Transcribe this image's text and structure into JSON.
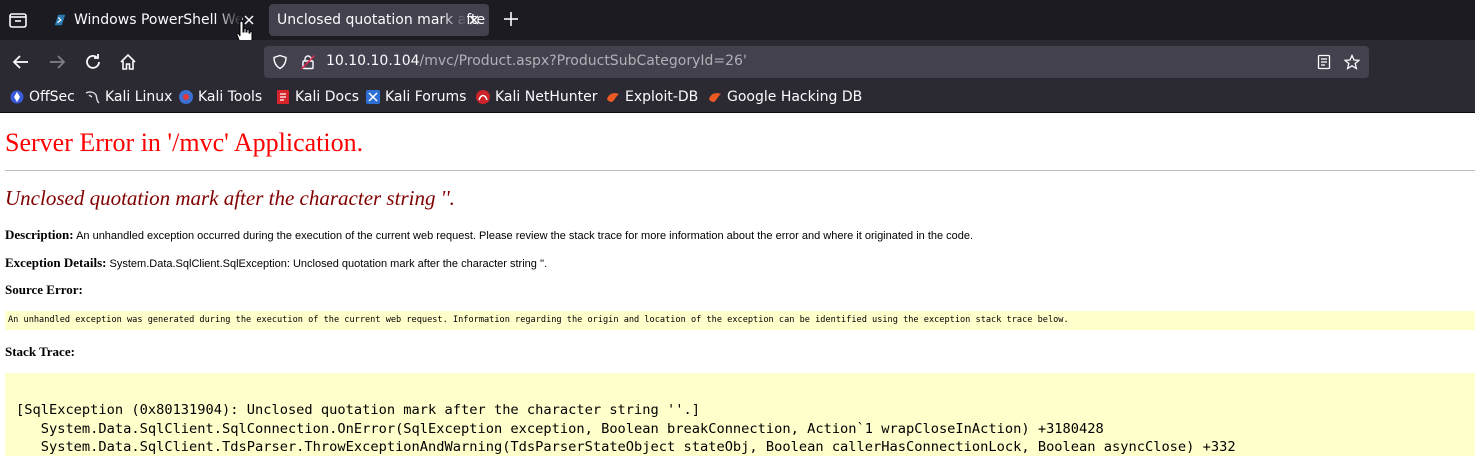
{
  "browser": {
    "tabs": [
      {
        "title": "Windows PowerShell We",
        "active": false
      },
      {
        "title": "Unclosed quotation mark afte",
        "active": true
      }
    ],
    "url": {
      "host": "10.10.10.104",
      "path": "/mvc/Product.aspx?ProductSubCategoryId=26'"
    },
    "bookmarks": [
      {
        "label": "OffSec",
        "icon": "offsec-icon"
      },
      {
        "label": "Kali Linux",
        "icon": "kali-dragon-icon"
      },
      {
        "label": "Kali Tools",
        "icon": "kali-tools-icon"
      },
      {
        "label": "Kali Docs",
        "icon": "kali-docs-icon"
      },
      {
        "label": "Kali Forums",
        "icon": "kali-forums-icon"
      },
      {
        "label": "Kali NetHunter",
        "icon": "nethunter-icon"
      },
      {
        "label": "Exploit-DB",
        "icon": "exploitdb-icon"
      },
      {
        "label": "Google Hacking DB",
        "icon": "ghdb-icon"
      }
    ]
  },
  "page": {
    "heading": "Server Error in '/mvc' Application.",
    "error_title": "Unclosed quotation mark after the character string ''.",
    "description_label": "Description:",
    "description_text": "An unhandled exception occurred during the execution of the current web request. Please review the stack trace for more information about the error and where it originated in the code.",
    "exception_label": "Exception Details:",
    "exception_text": "System.Data.SqlClient.SqlException: Unclosed quotation mark after the character string ''.",
    "source_error_label": "Source Error:",
    "source_error_text": "An unhandled exception was generated during the execution of the current web request. Information regarding the origin and location of the exception can be identified using the exception stack trace below.",
    "stack_trace_label": "Stack Trace:",
    "stack_trace": [
      "[SqlException (0x80131904): Unclosed quotation mark after the character string ''.]",
      "   System.Data.SqlClient.SqlConnection.OnError(SqlException exception, Boolean breakConnection, Action`1 wrapCloseInAction) +3180428",
      "   System.Data.SqlClient.TdsParser.ThrowExceptionAndWarning(TdsParserStateObject stateObj, Boolean callerHasConnectionLock, Boolean asyncClose) +332"
    ]
  },
  "colors": {
    "heading": "#ff0000",
    "error_title": "#800000",
    "code_background": "#ffffcc",
    "tabbar": "#1c1b22",
    "toolbar": "#2b2a33"
  }
}
